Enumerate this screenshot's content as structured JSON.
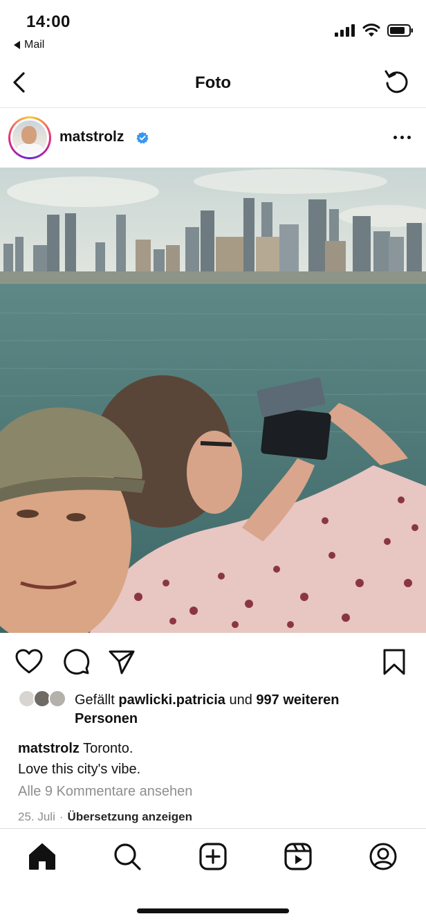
{
  "status_bar": {
    "time": "14:00",
    "back_app": "Mail"
  },
  "nav": {
    "title": "Foto"
  },
  "post": {
    "username": "matstrolz",
    "verified": true,
    "likes": {
      "prefix": "Gefällt",
      "user": "pawlicki.patricia",
      "connector": "und",
      "others": "997 weiteren Personen"
    },
    "caption": {
      "username": "matstrolz",
      "line1": "Toronto.",
      "line2": "Love this city's vibe."
    },
    "view_comments": "Alle 9 Kommentare ansehen",
    "date": "25. Juli",
    "translate": "Übersetzung anzeigen"
  },
  "icons": {
    "nav": [
      "back-chevron-icon",
      "refresh-icon"
    ],
    "post_actions": [
      "heart-icon",
      "comment-icon",
      "share-icon",
      "bookmark-icon"
    ],
    "tabbar": [
      "home-icon",
      "search-icon",
      "create-icon",
      "reels-icon",
      "profile-icon"
    ]
  },
  "colors": {
    "verified": "#3897f0",
    "secondary_text": "#8e8e8e"
  }
}
